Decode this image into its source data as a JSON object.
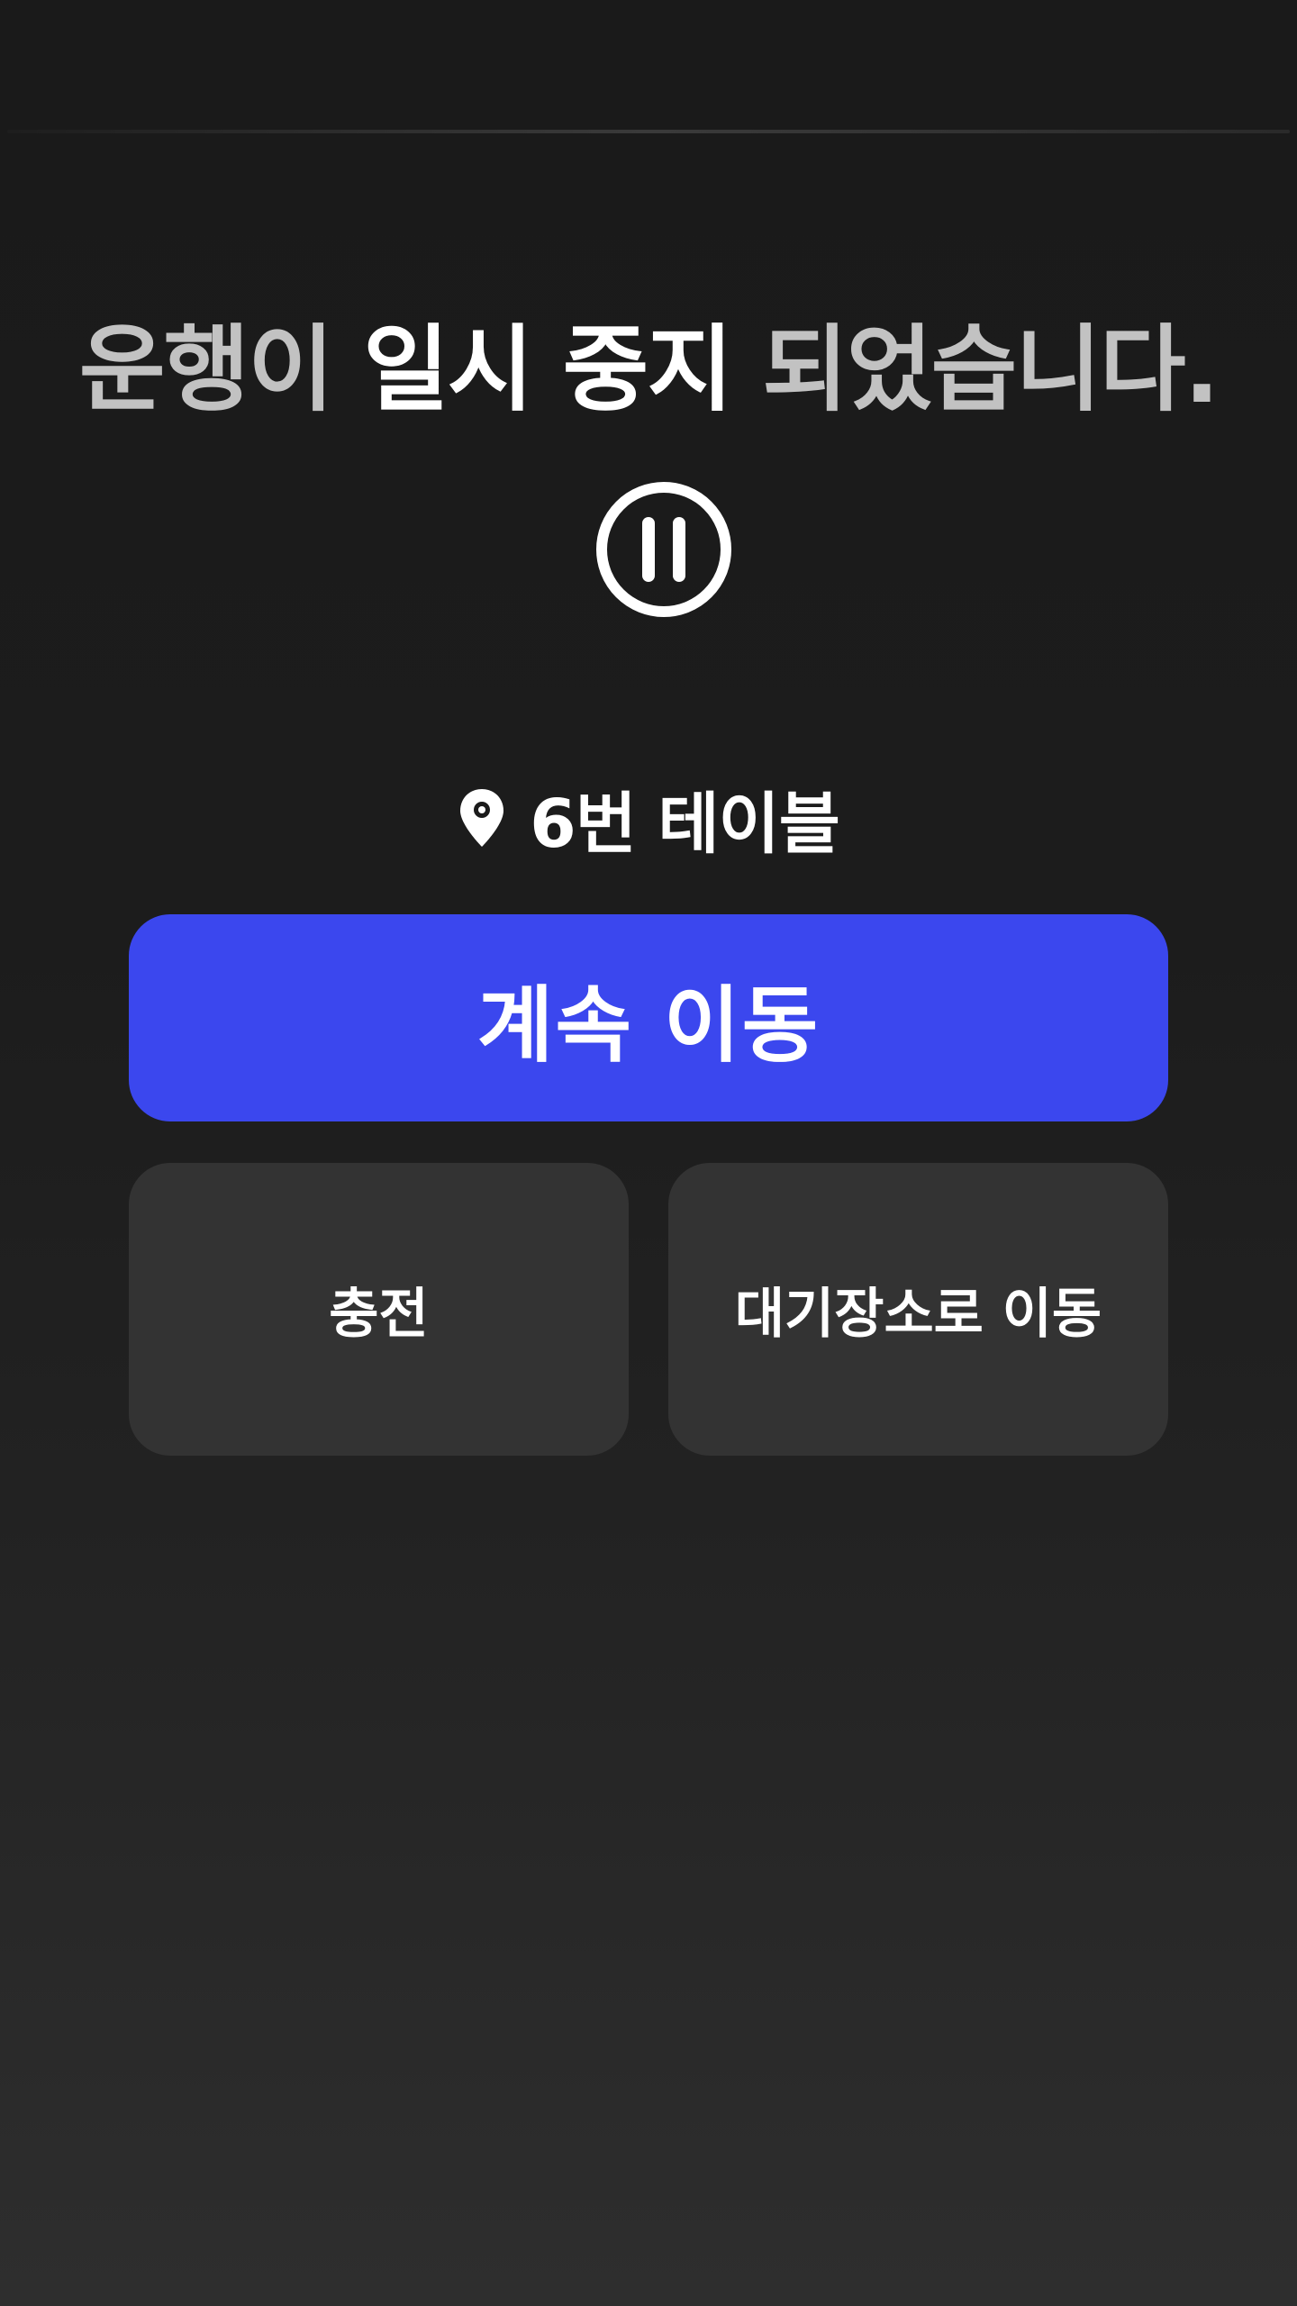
{
  "headline": {
    "prefix": "운행이",
    "emphasis": "일시 중지",
    "suffix": "되었습니다."
  },
  "status_icon": "pause-circle-icon",
  "location": {
    "icon": "map-pin-icon",
    "label": "6번 테이블"
  },
  "actions": {
    "continue_label": "계속 이동",
    "charge_label": "충전",
    "standby_label": "대기장소로 이동"
  },
  "colors": {
    "primary": "#3b47ee",
    "secondary": "#333333",
    "background": "#1a1a1a",
    "dim_text": "#c2c2c2"
  }
}
